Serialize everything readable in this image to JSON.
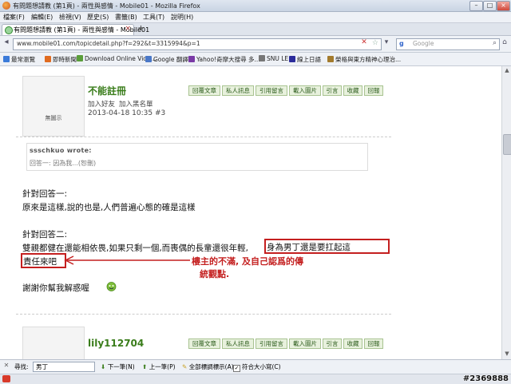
{
  "window": {
    "title": "有問題想請教 (第1頁) - 兩性與感情 - Mobile01 - Mozilla Firefox"
  },
  "menu": [
    "檔案(F)",
    "編輯(E)",
    "檢視(V)",
    "歷史(S)",
    "書籤(B)",
    "工具(T)",
    "說明(H)"
  ],
  "tab": {
    "label": "有問題想請教 (第1頁) - 兩性與感情 - Mobile01"
  },
  "nav": {
    "url": "www.mobile01.com/topicdetail.php?f=292&t=3315994&p=1",
    "search_placeholder": "Google",
    "search_engine_letter": "g"
  },
  "bookmarks": [
    {
      "label": "最常瀏覽",
      "color": "#3b7bd9"
    },
    {
      "label": "即時新聞",
      "color": "#e06b20"
    },
    {
      "label": "Download Online Vide...",
      "color": "#5a9e3a"
    },
    {
      "label": "Google 翻譯",
      "color": "#4a78c8"
    },
    {
      "label": "Yahoo!奇摩大搜尋 多...",
      "color": "#7a3aa6"
    },
    {
      "label": "SNU LE",
      "color": "#777777"
    },
    {
      "label": "線上日語",
      "color": "#2b2b9b"
    },
    {
      "label": "榮格與東方精神心理治...",
      "color": "#a37b2d"
    }
  ],
  "post1": {
    "avatar_text": "無圖示",
    "username": "不能註冊",
    "links": [
      "加入好友",
      "加入黑名單"
    ],
    "meta": "2013-04-18 10:35  #3",
    "buttons": [
      "回覆文章",
      "私人訊息",
      "引用留言",
      "載入圖片",
      "引言",
      "收藏",
      "回報"
    ]
  },
  "quote": {
    "header": "ssschkuo wrote:",
    "body": "回答一: 因為我...(恕刪)"
  },
  "body": {
    "line1": "針對回答一:",
    "line2": "原來是這樣,說的也是,人們普遍心態的確是這樣",
    "line3": "針對回答二:",
    "line4a": "雙親都健在還能相依畏,如果只剩一個,而喪偶的長輩還很年輕,",
    "line4b": "身為男丁還是要扛起這",
    "line5a": "責任來吧",
    "line6": "謝謝你幫我解惑喔"
  },
  "annotation": {
    "line1": "樓主的不滿, 及自己認爲的傳",
    "line2": "統觀點."
  },
  "post2": {
    "username": "lily112704",
    "buttons": [
      "回覆文章",
      "私人訊息",
      "引用留言",
      "載入圖片",
      "引言",
      "收藏",
      "回報"
    ]
  },
  "findbar": {
    "label": "尋找:",
    "value": "男丁",
    "next": "下一筆(N)",
    "prev": "上一筆(P)",
    "highlight": "全部標調標示(A)",
    "matchcase": "符合大小寫(C)"
  },
  "watermark": "#2369888"
}
